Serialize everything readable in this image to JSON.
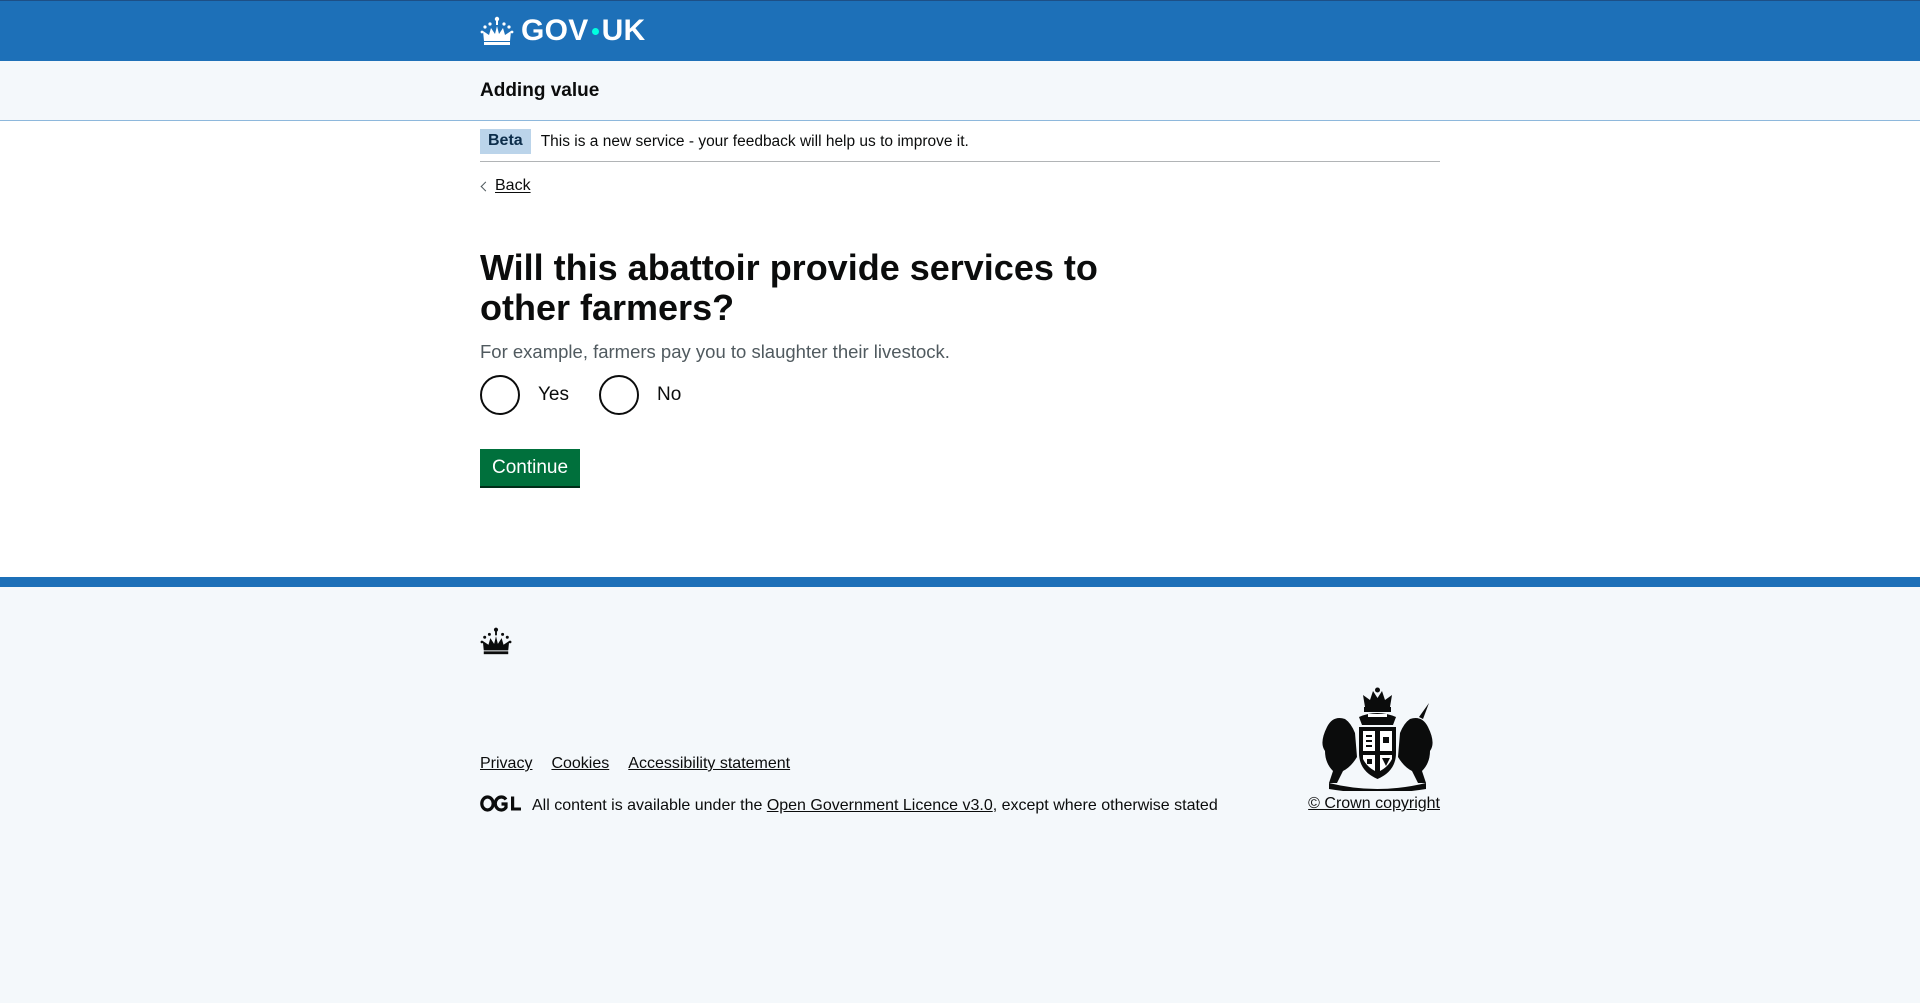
{
  "header": {
    "logo_text_left": "GOV",
    "logo_text_right": "UK",
    "logo_icon": "crown-icon"
  },
  "service": {
    "name": "Adding value"
  },
  "phase_banner": {
    "tag": "Beta",
    "text": "This is a new service - your feedback will help us to improve it."
  },
  "back_link": {
    "label": "Back"
  },
  "form": {
    "question": "Will this abattoir provide services to other farmers?",
    "hint": "For example, farmers pay you to slaughter their livestock.",
    "options": [
      {
        "label": "Yes",
        "selected": false
      },
      {
        "label": "No",
        "selected": false
      }
    ],
    "submit_label": "Continue"
  },
  "footer": {
    "links": [
      "Privacy",
      "Cookies",
      "Accessibility statement"
    ],
    "licence_prefix": "All content is available under the ",
    "licence_link": "Open Government Licence v3.0",
    "licence_suffix": ", except where otherwise stated",
    "copyright": "© Crown copyright",
    "logo_icon": "ogl-logo-icon",
    "crest_icon": "royal-coat-of-arms-icon"
  },
  "colors": {
    "header_blue": "#1d70b8",
    "button_green": "#00703c",
    "tag_blue": "#bbd4ea",
    "text": "#0b0c0c",
    "hint": "#505a5f"
  }
}
